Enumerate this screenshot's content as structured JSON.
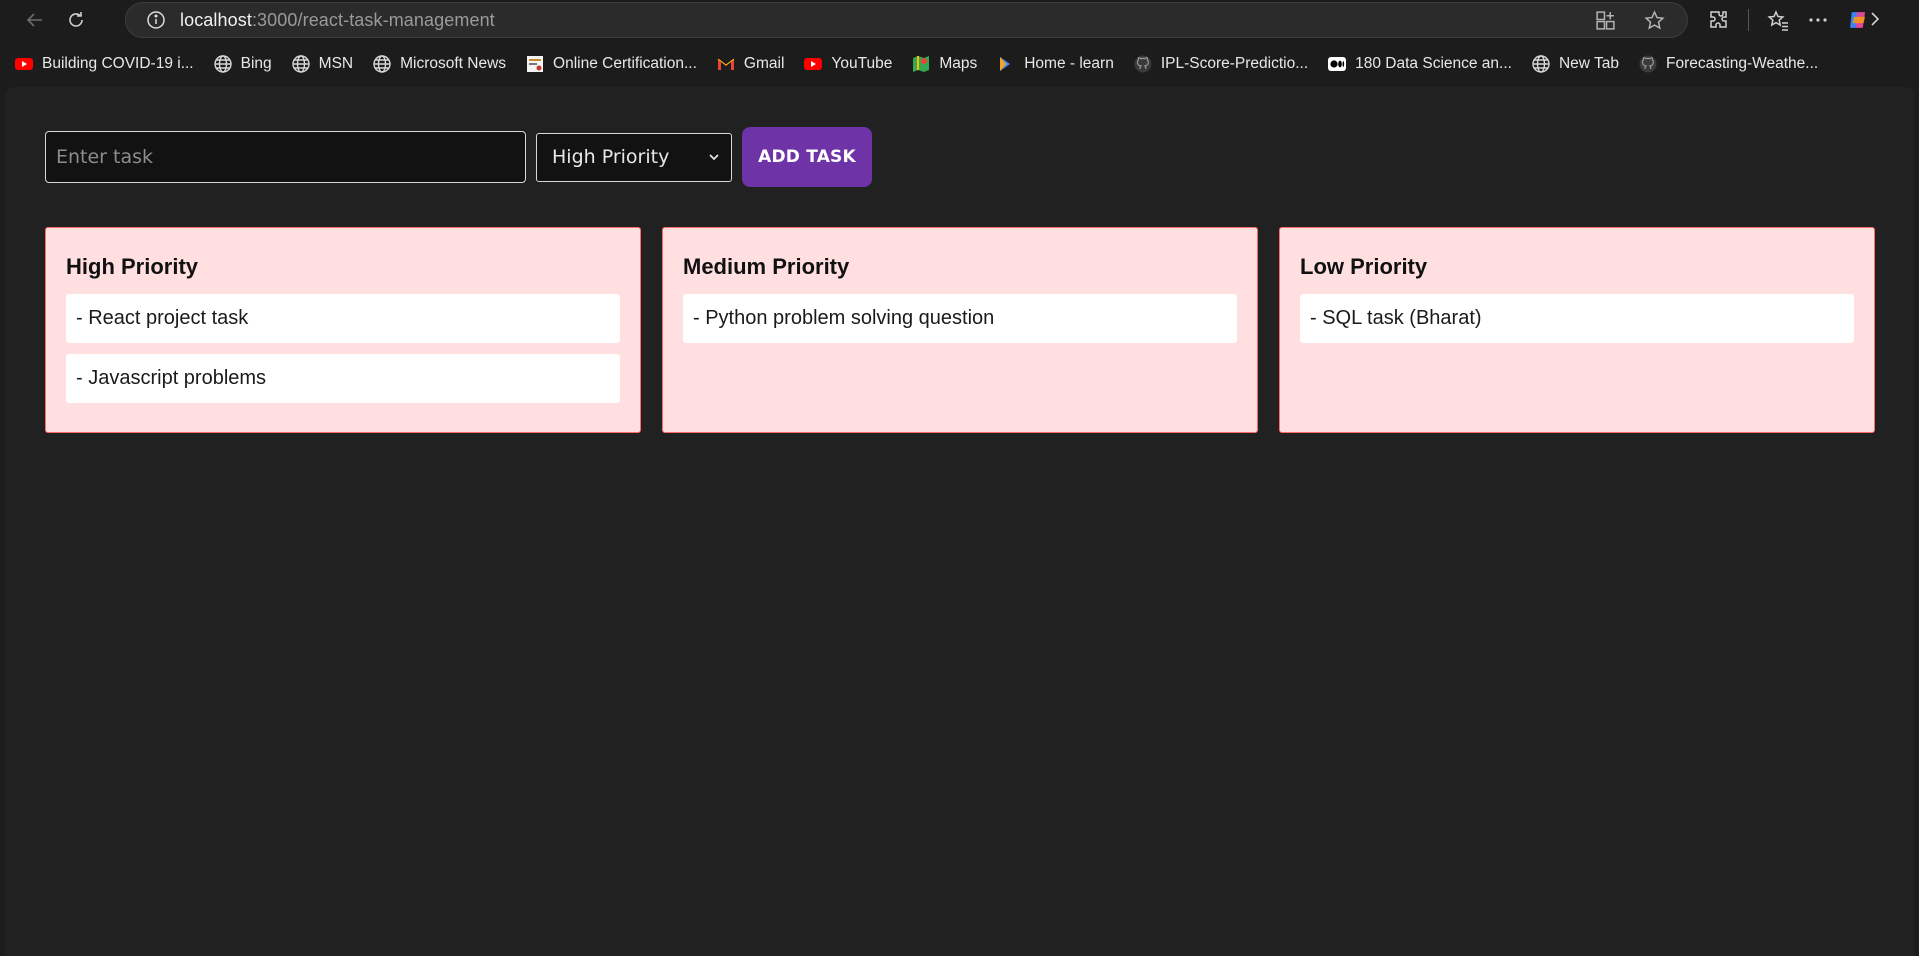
{
  "browser": {
    "url_host": "localhost",
    "url_path": ":3000/react-task-management"
  },
  "bookmarks": [
    {
      "label": "Building COVID-19 i...",
      "icon": "youtube-icon"
    },
    {
      "label": "Bing",
      "icon": "globe-icon"
    },
    {
      "label": "MSN",
      "icon": "globe-icon"
    },
    {
      "label": "Microsoft News",
      "icon": "globe-icon"
    },
    {
      "label": "Online Certification...",
      "icon": "certificate-icon"
    },
    {
      "label": "Gmail",
      "icon": "gmail-icon"
    },
    {
      "label": "YouTube",
      "icon": "youtube-icon"
    },
    {
      "label": "Maps",
      "icon": "maps-icon"
    },
    {
      "label": "Home - learn",
      "icon": "learn-icon"
    },
    {
      "label": "IPL-Score-Predictio...",
      "icon": "github-icon"
    },
    {
      "label": "180 Data Science an...",
      "icon": "medium-icon"
    },
    {
      "label": "New Tab",
      "icon": "globe-icon"
    },
    {
      "label": "Forecasting-Weathe...",
      "icon": "github-icon"
    }
  ],
  "form": {
    "task_placeholder": "Enter task",
    "task_value": "",
    "priority_selected": "High Priority",
    "add_button_label": "ADD TASK"
  },
  "columns": [
    {
      "title": "High Priority",
      "tasks": [
        "- React project task",
        "- Javascript problems"
      ]
    },
    {
      "title": "Medium Priority",
      "tasks": [
        "- Python problem solving question"
      ]
    },
    {
      "title": "Low Priority",
      "tasks": [
        "- SQL task (Bharat)"
      ]
    }
  ],
  "colors": {
    "page_bg": "#212121",
    "column_bg": "#ffdfe0",
    "column_border": "#ff6b6b",
    "add_button_bg": "#6e33a6"
  }
}
